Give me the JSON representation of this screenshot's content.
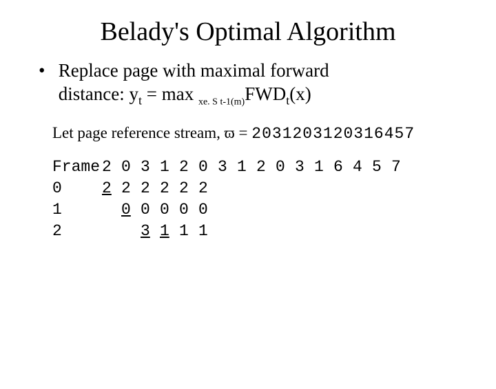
{
  "title": "Belady's Optimal Algorithm",
  "bullet": {
    "line1": "Replace page with maximal forward",
    "line2_a": "distance: y",
    "line2_sub_t": "t",
    "line2_b": " = max ",
    "line2_sub_xs": "xe. S t-1(m)",
    "line2_c": "FWD",
    "line2_sub_t2": "t",
    "line2_d": "(x)"
  },
  "stream": {
    "label": "Let page reference stream, ",
    "omega": "ϖ",
    "eq": " = ",
    "value": "2031203120316457"
  },
  "table": {
    "header_label": "Frame",
    "row_labels": [
      "0",
      "1",
      "2"
    ],
    "columns": [
      "2",
      "0",
      "3",
      "1",
      "2",
      "0",
      "3",
      "1",
      "2",
      "0",
      "3",
      "1",
      "6",
      "4",
      "5",
      "7"
    ],
    "rows": [
      [
        "2",
        "2",
        "2",
        "2",
        "2",
        "2",
        "",
        "",
        "",
        "",
        "",
        "",
        "",
        "",
        "",
        ""
      ],
      [
        "",
        "0",
        "0",
        "0",
        "0",
        "0",
        "",
        "",
        "",
        "",
        "",
        "",
        "",
        "",
        "",
        ""
      ],
      [
        "",
        "",
        "3",
        "1",
        "1",
        "1",
        "",
        "",
        "",
        "",
        "",
        "",
        "",
        "",
        "",
        ""
      ]
    ],
    "underline": [
      [
        true,
        false,
        false,
        false,
        false,
        false,
        false,
        false,
        false,
        false,
        false,
        false,
        false,
        false,
        false,
        false
      ],
      [
        false,
        true,
        false,
        false,
        false,
        false,
        false,
        false,
        false,
        false,
        false,
        false,
        false,
        false,
        false,
        false
      ],
      [
        false,
        false,
        true,
        true,
        false,
        false,
        false,
        false,
        false,
        false,
        false,
        false,
        false,
        false,
        false,
        false
      ]
    ]
  }
}
